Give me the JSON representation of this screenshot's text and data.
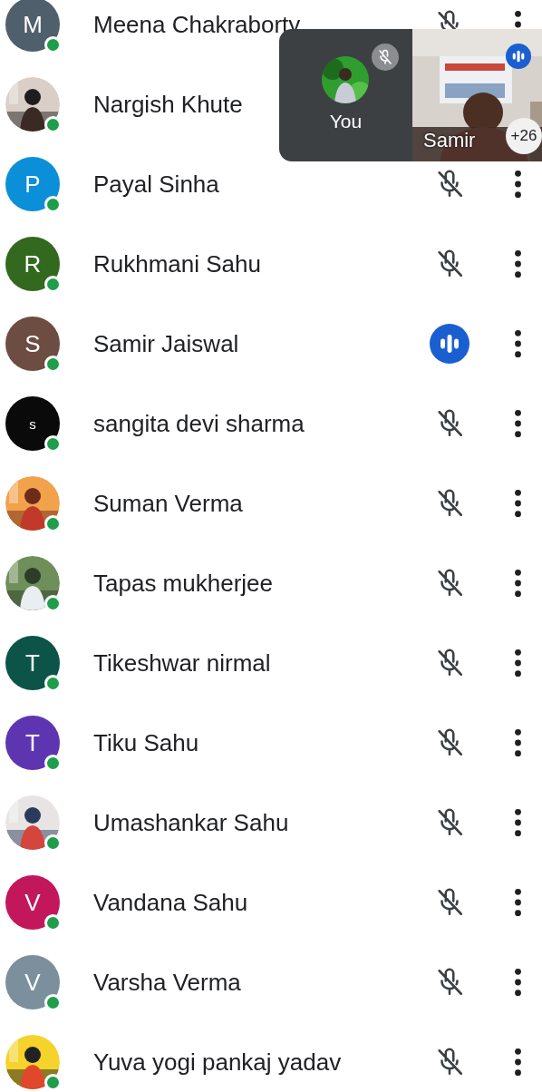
{
  "participants": [
    {
      "name": "Meena Chakraborty",
      "avatar": {
        "kind": "letter",
        "letter": "M",
        "color": "#4f5f6b"
      },
      "online": true,
      "muted": true
    },
    {
      "name": "Nargish Khute",
      "online": true
    },
    {
      "name": "Payal Sinha",
      "avatar": {
        "kind": "letter",
        "letter": "P",
        "color": "#0b8fd8"
      },
      "online": true,
      "muted": true
    },
    {
      "name": "Rukhmani Sahu",
      "avatar": {
        "kind": "letter",
        "letter": "R",
        "color": "#33691e"
      },
      "online": true,
      "muted": true
    },
    {
      "name": "Samir Jaiswal",
      "avatar": {
        "kind": "letter",
        "letter": "S",
        "color": "#6d4c41"
      },
      "online": true,
      "muted": false
    },
    {
      "name": "sangita devi sharma",
      "avatar": {
        "kind": "letter",
        "letter": "s",
        "color": "#0a0a0a"
      },
      "online": true,
      "muted": true
    },
    {
      "name": "Suman Verma",
      "online": true,
      "muted": true
    },
    {
      "name": "Tapas mukherjee",
      "online": true,
      "muted": true
    },
    {
      "name": "Tikeshwar nirmal",
      "avatar": {
        "kind": "letter",
        "letter": "T",
        "color": "#0c5448"
      },
      "online": true,
      "muted": true
    },
    {
      "name": "Tiku Sahu",
      "avatar": {
        "kind": "letter",
        "letter": "T",
        "color": "#5e35b1"
      },
      "online": true,
      "muted": true
    },
    {
      "name": "Umashankar Sahu",
      "online": true,
      "muted": true
    },
    {
      "name": "Vandana Sahu",
      "avatar": {
        "kind": "letter",
        "letter": "V",
        "color": "#c2185b"
      },
      "online": true,
      "muted": true
    },
    {
      "name": "Varsha Verma",
      "avatar": {
        "kind": "letter",
        "letter": "V",
        "color": "#7b909c"
      },
      "online": true,
      "muted": true
    },
    {
      "name": "Yuva yogi pankaj yadav",
      "online": true,
      "muted": true
    }
  ],
  "floating_call": {
    "self": {
      "label": "You",
      "muted": true
    },
    "speaker": {
      "name": "Samir",
      "muted": false
    },
    "more_count": "+26"
  }
}
